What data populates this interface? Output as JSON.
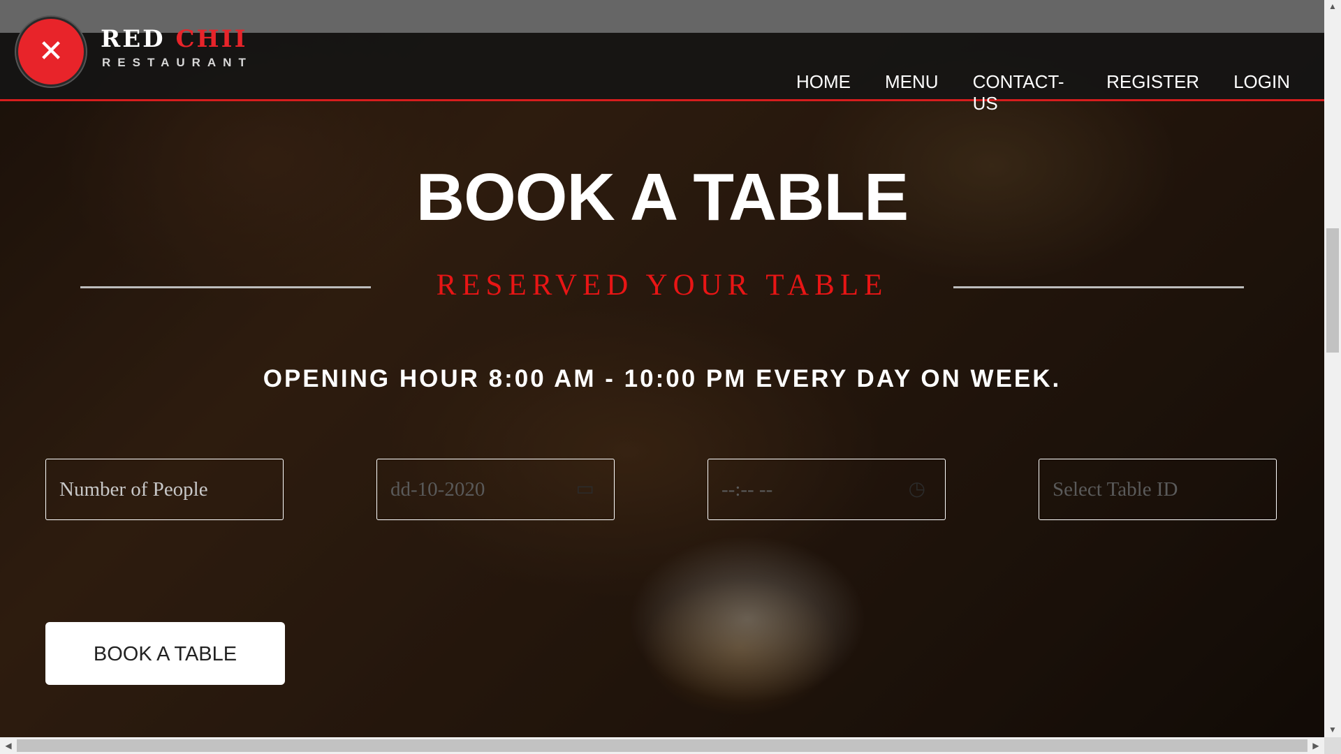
{
  "brand": {
    "name_part1": "RED ",
    "name_part2": "CHI",
    "name_part3": "I",
    "tagline": "RESTAURANT",
    "logo_icon": "fork-spoon-icon",
    "accent_color": "#e8242a"
  },
  "nav": {
    "items": [
      {
        "label": "HOME"
      },
      {
        "label": "MENU"
      },
      {
        "label": "CONTACT-US"
      },
      {
        "label": "REGISTER"
      },
      {
        "label": "LOGIN"
      }
    ]
  },
  "hero": {
    "title": "BOOK A TABLE",
    "subtitle": "RESERVED YOUR TABLE",
    "hours": "OPENING HOUR 8:00 AM - 10:00 PM EVERY DAY ON WEEK."
  },
  "form": {
    "people_placeholder": "Number of People",
    "date_value": "dd-10-2020",
    "date_icon": "calendar-icon",
    "time_value": "--:-- --",
    "time_icon": "clock-icon",
    "table_placeholder": "Select Table ID",
    "submit_label": "BOOK A TABLE"
  },
  "colors": {
    "nav_underline": "#d71d1d",
    "subtitle": "#e81515"
  }
}
